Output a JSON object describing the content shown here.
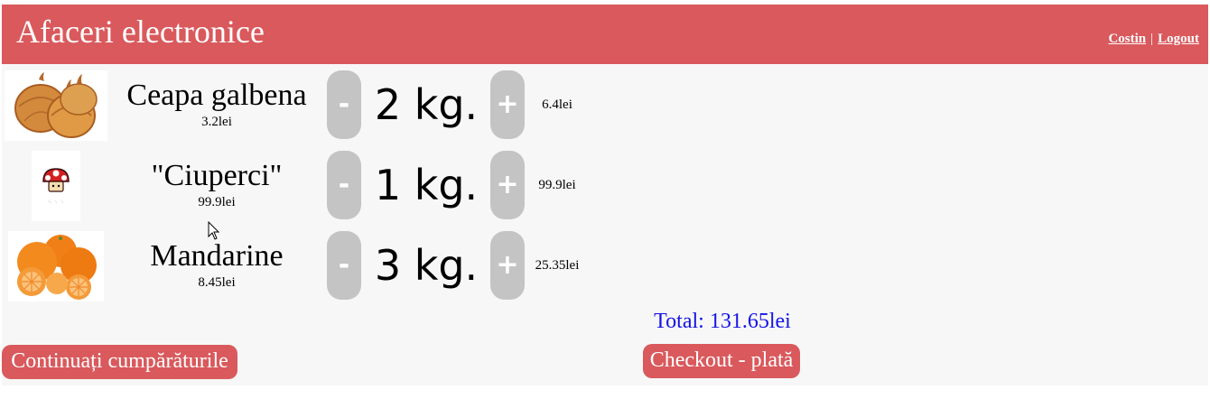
{
  "header": {
    "brand": "Afaceri electronice",
    "user_name": "Costin",
    "separator": "|",
    "logout": "Logout"
  },
  "cart": {
    "items": [
      {
        "name": "Ceapa galbena",
        "unit_price": "3.2lei",
        "quantity": "2 kg.",
        "line_total": "6.4lei",
        "minus": "-",
        "plus": "+",
        "image_icon": "onion-image"
      },
      {
        "name": "\"Ciuperci\"",
        "unit_price": "99.9lei",
        "quantity": "1 kg.",
        "line_total": "99.9lei",
        "minus": "-",
        "plus": "+",
        "image_icon": "mushroom-image"
      },
      {
        "name": "Mandarine",
        "unit_price": "8.45lei",
        "quantity": "3 kg.",
        "line_total": "25.35lei",
        "minus": "-",
        "plus": "+",
        "image_icon": "mandarin-image"
      }
    ],
    "total": "Total: 131.65lei"
  },
  "actions": {
    "continue_label": "Continuați cumpărăturile",
    "checkout_label": "Checkout - plată"
  },
  "colors": {
    "header_bg": "#d9595c",
    "page_bg": "#f7f7f7",
    "qty_button_bg": "#c4c4c4",
    "total_text": "#1414e6"
  }
}
